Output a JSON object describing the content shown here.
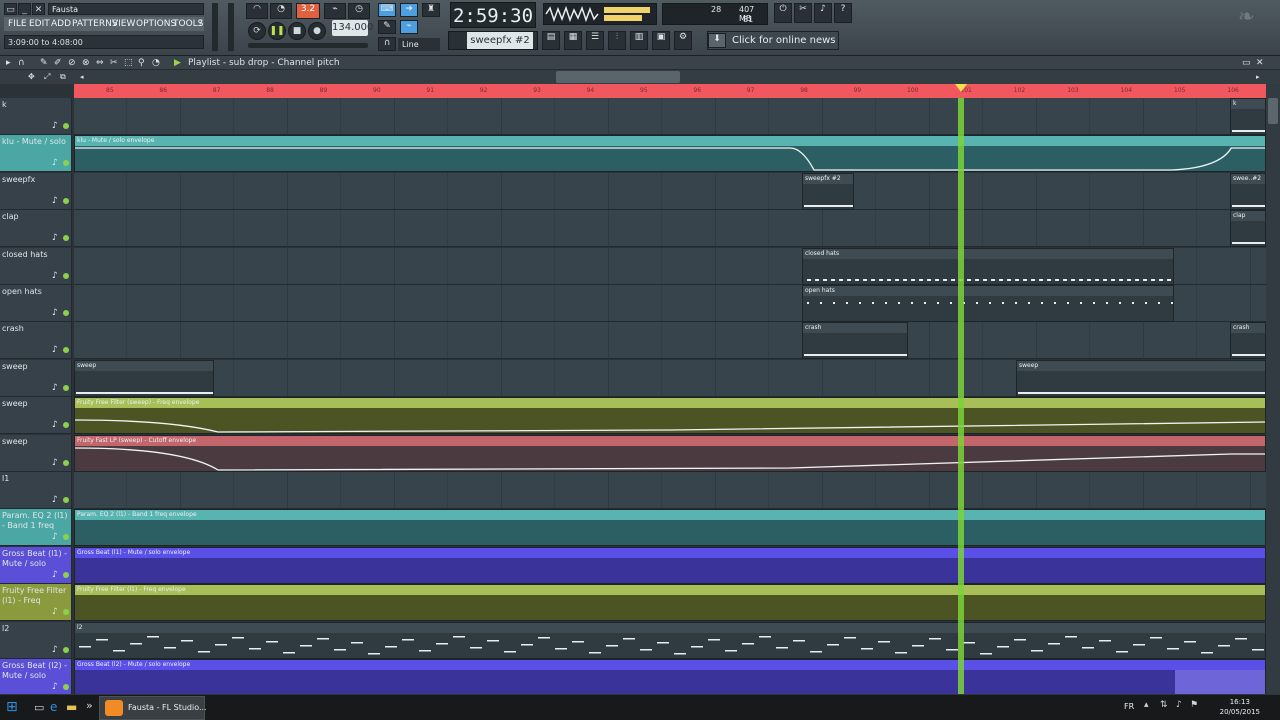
{
  "window": {
    "title": "Fausta",
    "time_range": "3:09:00 to 4:08:00"
  },
  "menu": [
    "FILE",
    "EDIT",
    "ADD",
    "PATTERNS",
    "VIEW",
    "OPTIONS",
    "TOOLS",
    "?"
  ],
  "transport": {
    "song_time": "2:59:30",
    "bpm": "134.000",
    "pattern": "sweepfx #2",
    "snap": "Line",
    "cpu_values": [
      "28",
      "407 MB",
      "81"
    ],
    "pattern_num": "3.2"
  },
  "news_label": "Click for online news",
  "playlist": {
    "title": "Playlist - sub drop - Channel pitch",
    "ruler": [
      "85",
      "86",
      "87",
      "88",
      "89",
      "90",
      "91",
      "92",
      "93",
      "94",
      "95",
      "96",
      "97",
      "98",
      "99",
      "100",
      "101",
      "102",
      "103",
      "104",
      "105",
      "106"
    ]
  },
  "tracks": [
    {
      "name": "k",
      "color": "#37414a"
    },
    {
      "name": "klu - Mute / solo",
      "color": "#4aa7a4"
    },
    {
      "name": "sweepfx",
      "color": "#37414a"
    },
    {
      "name": "clap",
      "color": "#37414a"
    },
    {
      "name": "closed hats",
      "color": "#37414a"
    },
    {
      "name": "open hats",
      "color": "#37414a"
    },
    {
      "name": "crash",
      "color": "#37414a"
    },
    {
      "name": "sweep",
      "color": "#37414a"
    },
    {
      "name": "sweep",
      "color": "#37414a"
    },
    {
      "name": "sweep",
      "color": "#37414a"
    },
    {
      "name": "l1",
      "color": "#37414a"
    },
    {
      "name": "Param. EQ 2 (l1) - Band 1 freq",
      "color": "#4aa7a4"
    },
    {
      "name": "Gross Beat (l1) - Mute / solo",
      "color": "#5a4fd6"
    },
    {
      "name": "Fruity Free Filter (l1) - Freq",
      "color": "#8a9a3c"
    },
    {
      "name": "l2",
      "color": "#37414a"
    },
    {
      "name": "Gross Beat (l2) - Mute / solo",
      "color": "#5a4fd6"
    }
  ],
  "clips": [
    {
      "track": 0,
      "label": "k",
      "type": "pattern"
    },
    {
      "track": 1,
      "label": "klu - Mute / solo envelope",
      "type": "envelope"
    },
    {
      "track": 2,
      "label": "sweepfx #2",
      "type": "pattern"
    },
    {
      "track": 2,
      "label": "swee..#2",
      "type": "pattern"
    },
    {
      "track": 3,
      "label": "clap",
      "type": "pattern"
    },
    {
      "track": 4,
      "label": "closed hats",
      "type": "pattern"
    },
    {
      "track": 5,
      "label": "open hats",
      "type": "pattern"
    },
    {
      "track": 6,
      "label": "crash",
      "type": "pattern"
    },
    {
      "track": 6,
      "label": "crash",
      "type": "pattern"
    },
    {
      "track": 7,
      "label": "sweep",
      "type": "pattern"
    },
    {
      "track": 7,
      "label": "sweep",
      "type": "pattern"
    },
    {
      "track": 8,
      "label": "Fruity Free Filter (sweep) - Freq envelope",
      "type": "envelope"
    },
    {
      "track": 9,
      "label": "Fruity Fast LP (sweep) - Cutoff envelope",
      "type": "envelope"
    },
    {
      "track": 11,
      "label": "Param. EQ 2 (l1) - Band 1 freq envelope",
      "type": "envelope"
    },
    {
      "track": 12,
      "label": "Gross Beat (l1) - Mute / solo envelope",
      "type": "envelope"
    },
    {
      "track": 13,
      "label": "Fruity Free Filter (l1) - Freq envelope",
      "type": "envelope"
    },
    {
      "track": 14,
      "label": "l2",
      "type": "pattern"
    },
    {
      "track": 15,
      "label": "Gross Beat (l2) - Mute / solo envelope",
      "type": "envelope"
    }
  ],
  "taskbar": {
    "app_label": "Fausta - FL Studio...",
    "lang": "FR",
    "time": "16:13",
    "date": "20/05/2015"
  }
}
